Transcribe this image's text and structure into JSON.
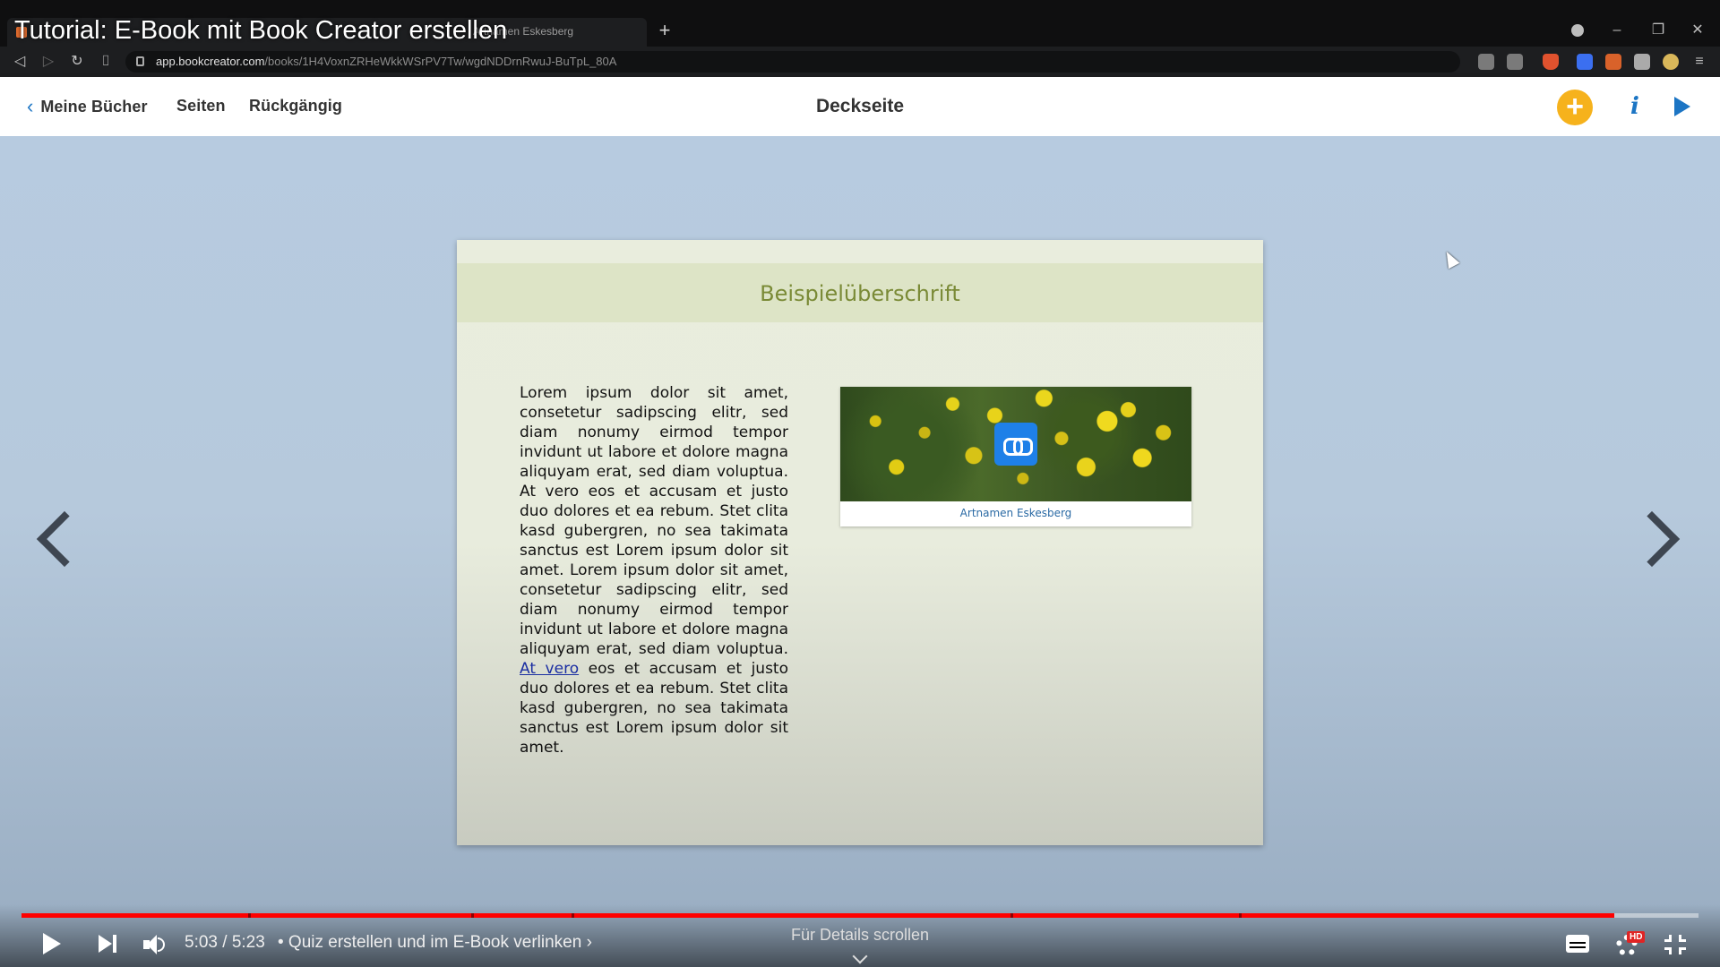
{
  "video": {
    "title": "Tutorial: E-Book mit Book Creator erstellen"
  },
  "browser": {
    "tab_label": "Artnamen Eskesberg",
    "url_host": "app.bookcreator.com",
    "url_path": "/books/1H4VoxnZRHeWkkWSrPV7Tw/wgdNDDrnRwuJ-BuTpL_80A",
    "icons": {
      "back": "arrow-back-icon",
      "forward": "arrow-forward-icon",
      "reload": "reload-icon",
      "bookmark": "bookmark-icon",
      "lock": "lock-icon",
      "menu": "menu-icon"
    }
  },
  "app_header": {
    "back_label": "Meine Bücher",
    "pages_label": "Seiten",
    "undo_label": "Rückgängig",
    "title": "Deckseite",
    "accent_color": "#f6b21c",
    "link_color": "#1c75c4"
  },
  "book_page": {
    "heading": "Beispielüberschrift",
    "body_before_link": "Lorem ipsum dolor sit amet, consetetur sadipscing elitr, sed diam nonumy eirmod tempor invidunt ut labore et dolore magna aliquyam erat, sed diam voluptua. At vero eos et accusam et justo duo dolores et ea rebum. Stet clita kasd gubergren, no sea takimata sanctus est Lorem ipsum dolor sit amet. Lorem ipsum dolor sit amet, consetetur sadipscing elitr, sed diam nonumy eirmod tempor invidunt ut labore et dolore magna aliquyam erat, sed diam voluptua.",
    "body_link": "At vero",
    "body_after_link": "eos et accusam et justo duo dolores et ea rebum. Stet clita kasd gubergren, no sea takimata sanctus est Lorem ipsum dolor sit amet.",
    "image_caption": "Artnamen Eskesberg",
    "heading_color": "#7a8a36",
    "heading_band_color": "#dde4c6"
  },
  "player": {
    "time": "5:03 / 5:23",
    "chapter": "• Quiz erstellen und im E-Book verlinken ›",
    "scroll_hint": "Für Details scrollen",
    "hd_badge": "HD",
    "progress": 0.95,
    "chapter_boundaries": [
      0.135,
      0.268,
      0.328,
      0.59,
      0.726
    ]
  }
}
